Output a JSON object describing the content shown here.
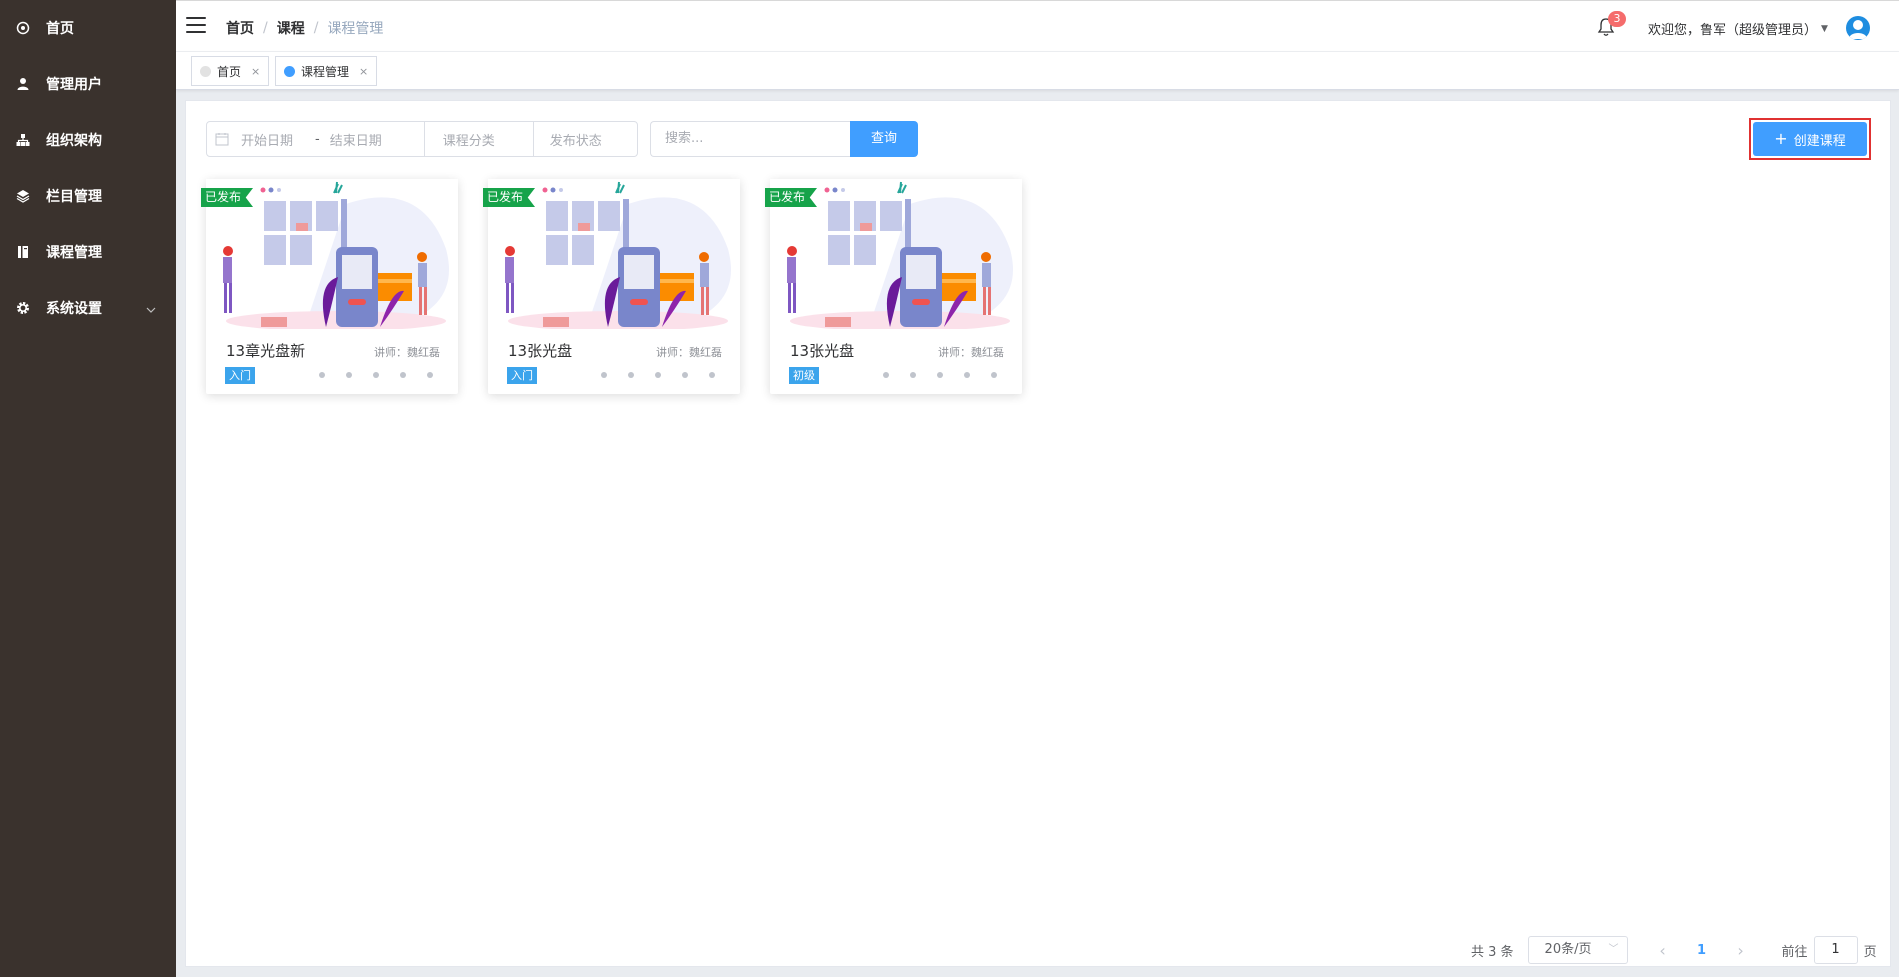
{
  "sidebar": {
    "items": [
      {
        "label": "首页",
        "icon": "dashboard-icon"
      },
      {
        "label": "管理用户",
        "icon": "user-icon"
      },
      {
        "label": "组织架构",
        "icon": "tree-icon"
      },
      {
        "label": "栏目管理",
        "icon": "layers-icon"
      },
      {
        "label": "课程管理",
        "icon": "book-icon"
      },
      {
        "label": "系统设置",
        "icon": "gear-icon"
      }
    ]
  },
  "header": {
    "breadcrumb": [
      "首页",
      "课程",
      "课程管理"
    ],
    "notification_count": "3",
    "welcome": "欢迎您，鲁军（超级管理员）"
  },
  "tags": [
    {
      "label": "首页",
      "close": "×",
      "active": false
    },
    {
      "label": "课程管理",
      "close": "×",
      "active": true
    }
  ],
  "filters": {
    "start_date_placeholder": "开始日期",
    "date_separator": "-",
    "end_date_placeholder": "结束日期",
    "category_placeholder": "课程分类",
    "status_placeholder": "发布状态",
    "search_placeholder": "搜索...",
    "query_label": "查询",
    "create_label": "创建课程",
    "create_icon": "+"
  },
  "courses": [
    {
      "status": "已发布",
      "title": "13章光盘新",
      "teacher": "讲师：魏红磊",
      "level": "入门"
    },
    {
      "status": "已发布",
      "title": "13张光盘",
      "teacher": "讲师：魏红磊",
      "level": "入门"
    },
    {
      "status": "已发布",
      "title": "13张光盘",
      "teacher": "讲师：魏红磊",
      "level": "初级"
    }
  ],
  "pagination": {
    "total": "共 3 条",
    "page_size": "20条/页",
    "current_page": "1",
    "goto_label": "前往",
    "goto_value": "1",
    "page_suffix": "页"
  },
  "colors": {
    "primary": "#409eff",
    "sidebar_bg": "#3a322d",
    "published": "#16a34a",
    "badge": "#f56c6c"
  }
}
